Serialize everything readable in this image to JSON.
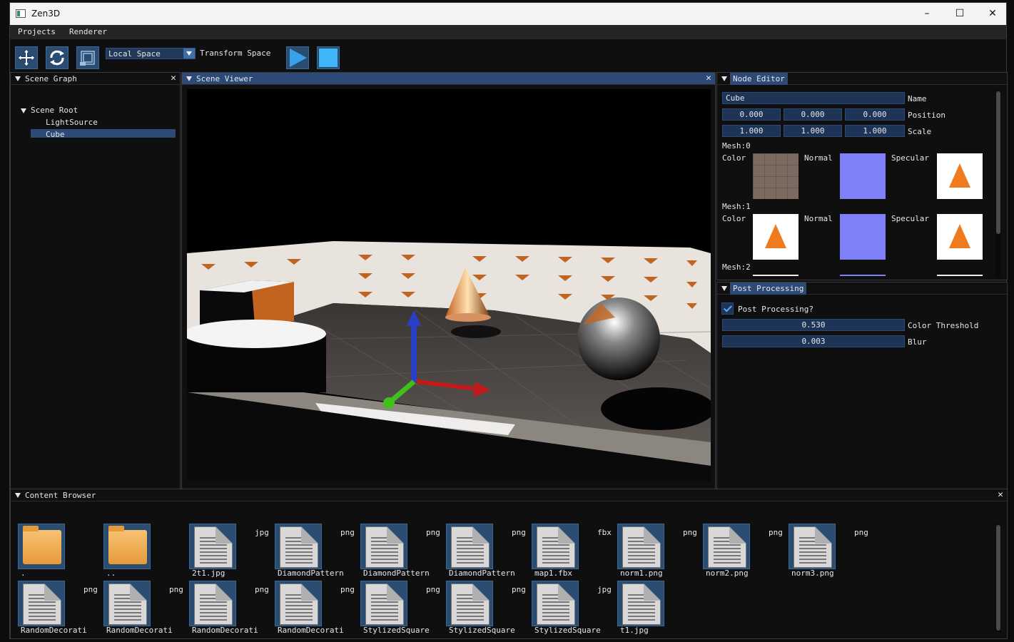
{
  "window": {
    "title": "Zen3D",
    "minimize": "–",
    "maximize": "☐",
    "close": "✕"
  },
  "menu": {
    "projects": "Projects",
    "renderer": "Renderer"
  },
  "toolbar": {
    "move_icon": "move-icon",
    "rotate_icon": "rotate-icon",
    "scale_icon": "scale-icon",
    "space_value": "Local Space",
    "space_label": "Transform Space",
    "play_icon": "play-icon",
    "stop_icon": "stop-icon"
  },
  "scene_graph": {
    "title": "Scene Graph",
    "close": "✕",
    "root": "Scene Root",
    "children": [
      "LightSource",
      "Cube"
    ],
    "selected": "Cube"
  },
  "scene_viewer": {
    "title": "Scene Viewer",
    "close": "✕"
  },
  "node_editor": {
    "title": "Node Editor",
    "name_value": "Cube",
    "name_label": "Name",
    "position": [
      "0.000",
      "0.000",
      "0.000"
    ],
    "position_label": "Position",
    "scale": [
      "1.000",
      "1.000",
      "1.000"
    ],
    "scale_label": "Scale",
    "meshes": [
      {
        "label": "Mesh:0",
        "color": "Color",
        "normal": "Normal",
        "specular": "Specular"
      },
      {
        "label": "Mesh:1",
        "color": "Color",
        "normal": "Normal",
        "specular": "Specular"
      },
      {
        "label": "Mesh:2"
      }
    ]
  },
  "post_processing": {
    "title": "Post Processing",
    "enabled_label": "Post Processing?",
    "enabled": true,
    "threshold_value": "0.530",
    "threshold_label": "Color Threshold",
    "blur_value": "0.003",
    "blur_label": "Blur"
  },
  "content_browser": {
    "title": "Content Browser",
    "close": "✕",
    "items": [
      {
        "name": ".",
        "ext": "",
        "type": "folder"
      },
      {
        "name": "..",
        "ext": "",
        "type": "folder"
      },
      {
        "name": "2t1.jpg",
        "ext": "jpg",
        "type": "file"
      },
      {
        "name": "DiamondPattern",
        "ext": "png",
        "type": "file"
      },
      {
        "name": "DiamondPattern",
        "ext": "png",
        "type": "file"
      },
      {
        "name": "DiamondPattern",
        "ext": "png",
        "type": "file"
      },
      {
        "name": "map1.fbx",
        "ext": "fbx",
        "type": "file"
      },
      {
        "name": "norm1.png",
        "ext": "png",
        "type": "file"
      },
      {
        "name": "norm2.png",
        "ext": "png",
        "type": "file"
      },
      {
        "name": "norm3.png",
        "ext": "png",
        "type": "file"
      },
      {
        "name": "RandomDecorati",
        "ext": "png",
        "type": "file"
      },
      {
        "name": "RandomDecorati",
        "ext": "png",
        "type": "file"
      },
      {
        "name": "RandomDecorati",
        "ext": "png",
        "type": "file"
      },
      {
        "name": "RandomDecorati",
        "ext": "png",
        "type": "file"
      },
      {
        "name": "StylizedSquare",
        "ext": "png",
        "type": "file"
      },
      {
        "name": "StylizedSquare",
        "ext": "png",
        "type": "file"
      },
      {
        "name": "StylizedSquare",
        "ext": "jpg",
        "type": "file"
      },
      {
        "name": "t1.jpg",
        "ext": "",
        "type": "file"
      }
    ]
  },
  "colors": {
    "accent": "#2d4a76",
    "field": "#1e3456",
    "play": "#3aa0e8"
  }
}
